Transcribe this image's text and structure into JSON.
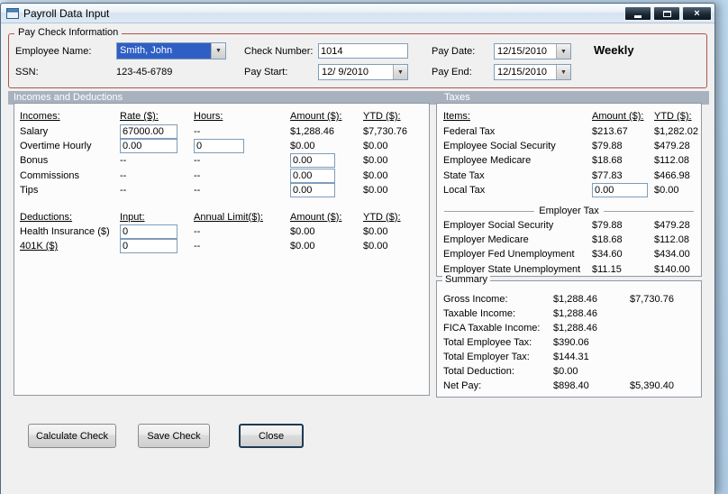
{
  "window": {
    "title": "Payroll Data Input"
  },
  "icons": {
    "close_glyph": "×",
    "dropdown_arrow": "▼"
  },
  "paycheck": {
    "group_label": "Pay Check Information",
    "employee_name_label": "Employee Name:",
    "employee_name_value": "Smith, John",
    "ssn_label": "SSN:",
    "ssn_value": "123-45-6789",
    "check_number_label": "Check Number:",
    "check_number_value": "1014",
    "pay_start_label": "Pay Start:",
    "pay_start_value": "12/ 9/2010",
    "pay_date_label": "Pay Date:",
    "pay_date_value": "12/15/2010",
    "pay_end_label": "Pay End:",
    "pay_end_value": "12/15/2010",
    "frequency": "Weekly"
  },
  "sections": {
    "left": "Incomes and Deductions",
    "right": "Taxes"
  },
  "incomes": {
    "headers": {
      "label": "Incomes:",
      "rate": "Rate ($):",
      "hours": "Hours:",
      "amount": "Amount ($):",
      "ytd": "YTD ($):"
    },
    "rows": [
      {
        "label": "Salary",
        "rate": "67000.00",
        "hours": "--",
        "amount": "$1,288.46",
        "ytd": "$7,730.76"
      },
      {
        "label": "Overtime Hourly",
        "rate": "0.00",
        "hours": "0",
        "amount": "$0.00",
        "ytd": "$0.00"
      },
      {
        "label": "Bonus",
        "rate": "--",
        "hours": "--",
        "amount": "0.00",
        "ytd": "$0.00"
      },
      {
        "label": "Commissions",
        "rate": "--",
        "hours": "--",
        "amount": "0.00",
        "ytd": "$0.00"
      },
      {
        "label": "Tips",
        "rate": "--",
        "hours": "--",
        "amount": "0.00",
        "ytd": "$0.00"
      }
    ]
  },
  "deductions": {
    "headers": {
      "label": "Deductions:",
      "input": "Input:",
      "limit": "Annual Limit($):",
      "amount": "Amount ($):",
      "ytd": "YTD ($):"
    },
    "rows": [
      {
        "label": "Health Insurance  ($)",
        "input": "0",
        "limit": "--",
        "amount": "$0.00",
        "ytd": "$0.00"
      },
      {
        "label": "401K  ($)",
        "input": "0",
        "limit": "--",
        "amount": "$0.00",
        "ytd": "$0.00"
      }
    ]
  },
  "taxes": {
    "headers": {
      "label": "Items:",
      "amount": "Amount ($):",
      "ytd": "YTD ($):"
    },
    "employee_rows": [
      {
        "label": "Federal Tax",
        "amount": "$213.67",
        "ytd": "$1,282.02"
      },
      {
        "label": "Employee Social Security",
        "amount": "$79.88",
        "ytd": "$479.28"
      },
      {
        "label": "Employee Medicare",
        "amount": "$18.68",
        "ytd": "$112.08"
      },
      {
        "label": "State Tax",
        "amount": "$77.83",
        "ytd": "$466.98"
      },
      {
        "label": "Local Tax",
        "amount": "0.00",
        "ytd": "$0.00"
      }
    ],
    "divider_label": "Employer Tax",
    "employer_rows": [
      {
        "label": "Employer Social Security",
        "amount": "$79.88",
        "ytd": "$479.28"
      },
      {
        "label": "Employer Medicare",
        "amount": "$18.68",
        "ytd": "$112.08"
      },
      {
        "label": "Employer Fed Unemployment",
        "amount": "$34.60",
        "ytd": "$434.00"
      },
      {
        "label": "Employer State Unemployment",
        "amount": "$11.15",
        "ytd": "$140.00"
      }
    ]
  },
  "summary": {
    "group_label": "Summary",
    "rows": [
      {
        "label": "Gross Income:",
        "amount": "$1,288.46",
        "ytd": "$7,730.76"
      },
      {
        "label": "Taxable Income:",
        "amount": "$1,288.46",
        "ytd": ""
      },
      {
        "label": "FICA Taxable Income:",
        "amount": "$1,288.46",
        "ytd": ""
      },
      {
        "label": "Total Employee Tax:",
        "amount": "$390.06",
        "ytd": ""
      },
      {
        "label": "Total Employer Tax:",
        "amount": "$144.31",
        "ytd": ""
      },
      {
        "label": "Total Deduction:",
        "amount": "$0.00",
        "ytd": ""
      },
      {
        "label": "Net Pay:",
        "amount": "$898.40",
        "ytd": "$5,390.40"
      }
    ]
  },
  "buttons": {
    "calculate": "Calculate Check",
    "save": "Save Check",
    "close": "Close"
  },
  "colors": {
    "paycheck_group_border": "#b0544a",
    "section_bar": "#a8b2bf",
    "combo_selection_bg": "#2f5fc4",
    "window_button_bg": "#1b2836",
    "desktop_background": "#bcd6ec"
  }
}
